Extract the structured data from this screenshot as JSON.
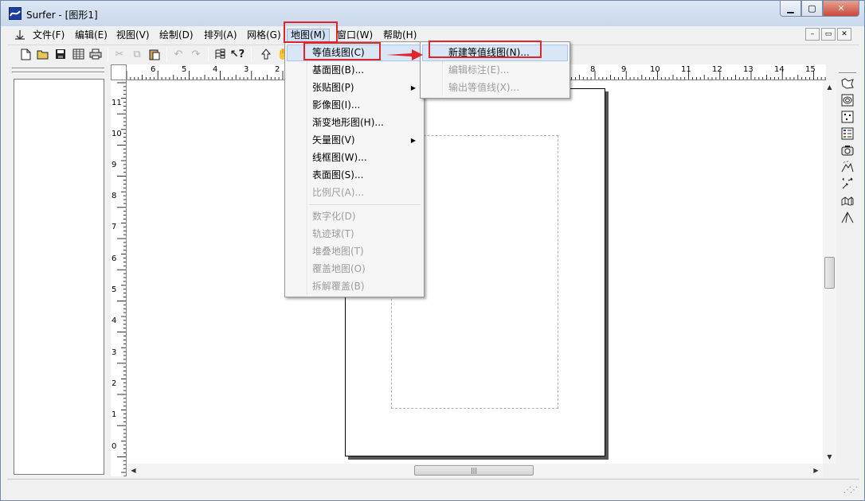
{
  "window": {
    "title": "Surfer - [图形1]",
    "controls": {
      "minimize": "▁",
      "maximize": "▢",
      "close": "✕"
    }
  },
  "menubar": {
    "items": [
      {
        "label": "文件(F)"
      },
      {
        "label": "编辑(E)"
      },
      {
        "label": "视图(V)"
      },
      {
        "label": "绘制(D)"
      },
      {
        "label": "排列(A)"
      },
      {
        "label": "网格(G)"
      },
      {
        "label": "地图(M)",
        "active": true
      },
      {
        "label": "窗口(W)"
      },
      {
        "label": "帮助(H)"
      }
    ],
    "mdi_controls": [
      "–",
      "▭",
      "✕"
    ]
  },
  "toolbar": {
    "buttons": [
      "new-file-icon",
      "open-folder-icon",
      "save-icon",
      "worksheet-icon",
      "print-icon",
      "cut-icon",
      "copy-icon",
      "paste-icon",
      "undo-icon",
      "redo-icon",
      "object-manager-icon",
      "context-help-icon",
      "select-arrow-icon",
      "pan-hand-icon"
    ]
  },
  "map_menu": {
    "items": [
      {
        "label": "等值线图(C)",
        "highlighted": true,
        "submenu": true
      },
      {
        "label": "基面图(B)..."
      },
      {
        "label": "张贴图(P)",
        "submenu": true
      },
      {
        "label": "影像图(I)..."
      },
      {
        "label": "渐变地形图(H)..."
      },
      {
        "label": "矢量图(V)",
        "submenu": true
      },
      {
        "label": "线框图(W)..."
      },
      {
        "label": "表面图(S)..."
      },
      {
        "label": "比例尺(A)...",
        "disabled": true
      },
      {
        "label": "数字化(D)",
        "disabled": true
      },
      {
        "label": "轨迹球(T)",
        "disabled": true
      },
      {
        "label": "堆叠地图(T)",
        "disabled": true
      },
      {
        "label": "覆盖地图(O)",
        "disabled": true
      },
      {
        "label": "拆解覆盖(B)",
        "disabled": true
      }
    ]
  },
  "contour_submenu": {
    "items": [
      {
        "label": "新建等值线图(N)...",
        "highlighted": true
      },
      {
        "label": "编辑标注(E)...",
        "disabled": true
      },
      {
        "label": "输出等值线(X)...",
        "disabled": true
      }
    ]
  },
  "rulers": {
    "horizontal_labels": [
      "6",
      "5",
      "4",
      "3",
      "2",
      "8",
      "9",
      "10",
      "11",
      "12",
      "13",
      "14",
      "15"
    ],
    "vertical_labels": [
      "11",
      "10",
      "9",
      "8",
      "7",
      "6",
      "5",
      "4",
      "3",
      "2",
      "1",
      "0"
    ]
  },
  "right_toolbar": {
    "buttons": [
      "base-map-icon",
      "contour-map-icon",
      "post-map-icon",
      "classed-post-icon",
      "image-map-icon",
      "shaded-relief-icon",
      "vector-map-icon",
      "wireframe-icon",
      "surface-icon"
    ]
  },
  "colors": {
    "annotation_red": "#e0262b",
    "menu_highlight": "#d8e6f6"
  }
}
